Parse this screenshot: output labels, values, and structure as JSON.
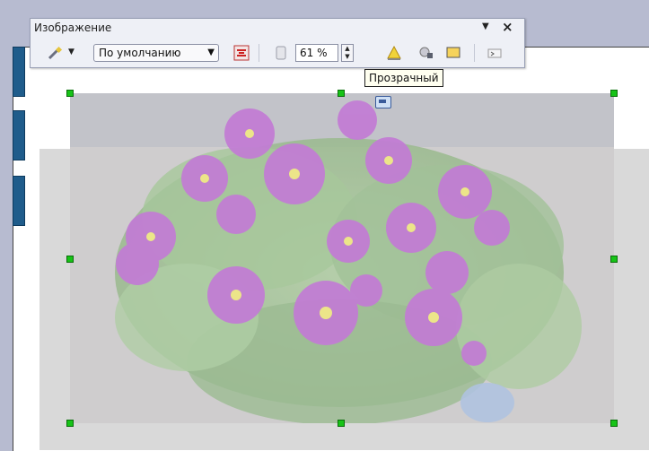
{
  "toolbar": {
    "title": "Изображение",
    "filter_icon": "wand-icon",
    "graphics_mode_value": "По умолчанию",
    "transparency_value": "61 %",
    "tooltip": "Прозрачный",
    "icons": {
      "menu": "chevron-down-icon",
      "close": "close-icon",
      "color": "color-icon",
      "transparency": "transparency-icon",
      "crop": "crop-icon",
      "frame": "frame-icon",
      "properties": "properties-icon"
    }
  },
  "colors": {
    "handle": "#17c317",
    "toolbar_bg": "#eef0f6",
    "ruler": "#1f5c8b"
  }
}
